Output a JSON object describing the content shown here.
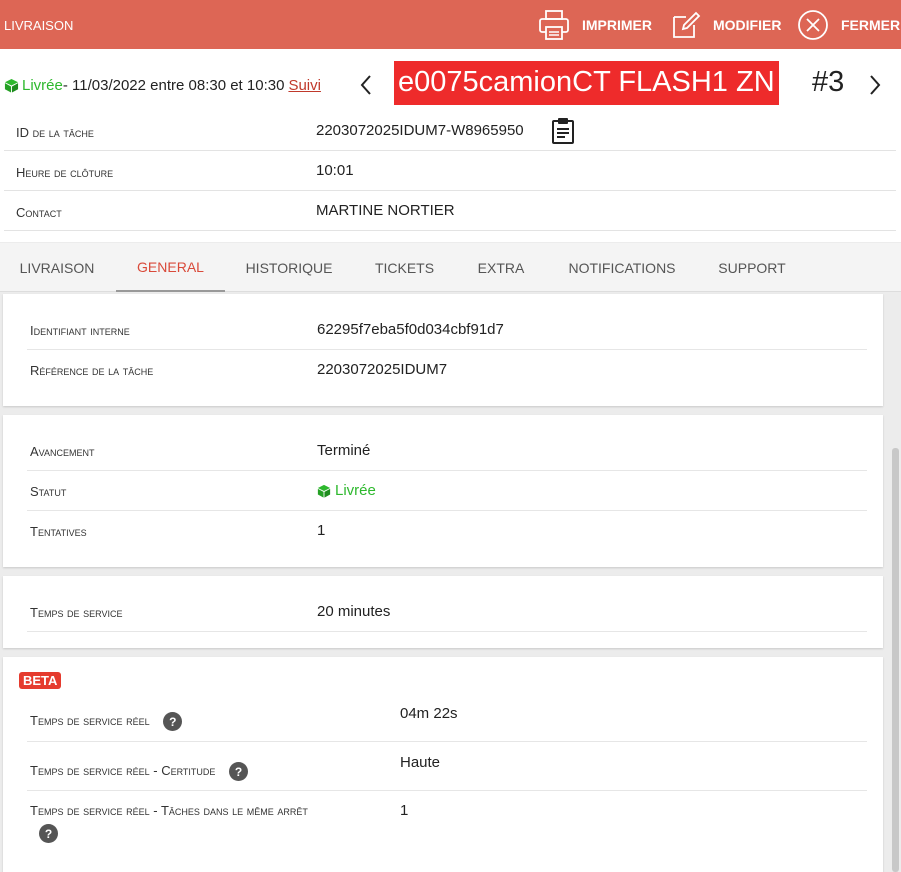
{
  "topbar": {
    "title": "LIVRAISON",
    "print_label": "IMPRIMER",
    "edit_label": "MODIFIER",
    "close_label": "FERMER",
    "bg_color": "#dd6655"
  },
  "status": {
    "label": "Livrée",
    "schedule": " - 11/03/2022 entre 08:30 et 10:30",
    "follow_link": "Suivi",
    "color": "#2db82d"
  },
  "vehicle": {
    "name": "e0075camionCT FLASH1 ZN",
    "number": "#3",
    "badge_color": "#ee2b2b"
  },
  "task_info": [
    {
      "label": "ID de la tâche",
      "value": "2203072025IDUM7-W8965950"
    },
    {
      "label": "Heure de clôture",
      "value": "10:01"
    },
    {
      "label": "Contact",
      "value": "MARTINE NORTIER"
    }
  ],
  "tabs": [
    "LIVRAISON",
    "GENERAL",
    "HISTORIQUE",
    "TICKETS",
    "EXTRA",
    "NOTIFICATIONS",
    "SUPPORT"
  ],
  "active_tab": "GENERAL",
  "general": {
    "ids": [
      {
        "label": "Identifiant interne",
        "value": "62295f7eba5f0d034cbf91d7"
      },
      {
        "label": "Référence de la tâche",
        "value": "2203072025IDUM7"
      }
    ],
    "progress": [
      {
        "label": "Avancement",
        "value": "Terminé"
      },
      {
        "label": "Statut",
        "value": "Livrée"
      },
      {
        "label": "Tentatives",
        "value": "1"
      }
    ],
    "service": [
      {
        "label": "Temps de service",
        "value": "20 minutes"
      }
    ],
    "beta_label": "BETA",
    "beta": [
      {
        "label": "Temps de service réel",
        "value": "04m 22s"
      },
      {
        "label": "Temps de service réel - Certitude",
        "value": "Haute"
      },
      {
        "label": "Temps de service réel - Tâches dans le même arrêt",
        "value": "1"
      }
    ]
  },
  "help_glyph": "?",
  "icons": [
    "printer-icon",
    "edit-icon",
    "close-circle-icon",
    "cube-icon",
    "chevron-left-icon",
    "chevron-right-icon",
    "clipboard-icon",
    "help-icon"
  ]
}
